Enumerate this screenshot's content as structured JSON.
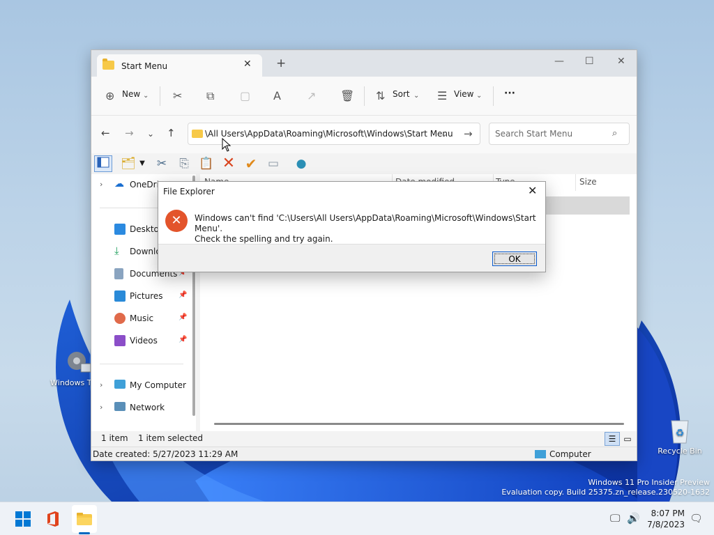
{
  "explorer": {
    "tab_title": "Start Menu",
    "tab_close": "✕",
    "new_tab": "+",
    "window_controls": {
      "minimize": "—",
      "maximize": "☐",
      "close": "✕"
    },
    "commands": {
      "new_label": "New",
      "sort_label": "Sort",
      "view_label": "View",
      "more_label": "···"
    },
    "address_path": "\\All Users\\AppData\\Roaming\\Microsoft\\Windows\\Start Menu",
    "search_placeholder": "Search Start Menu",
    "nav_items": [
      {
        "label": "OneDrive",
        "icon": "cloud-icon"
      },
      {
        "label": "Desktop",
        "icon": "desktop-icon"
      },
      {
        "label": "Downloads",
        "icon": "download-icon"
      },
      {
        "label": "Documents",
        "icon": "documents-icon"
      },
      {
        "label": "Pictures",
        "icon": "pictures-icon"
      },
      {
        "label": "Music",
        "icon": "music-icon"
      },
      {
        "label": "Videos",
        "icon": "videos-icon"
      },
      {
        "label": "My Computer",
        "icon": "computer-icon"
      },
      {
        "label": "Network",
        "icon": "network-icon"
      }
    ],
    "columns": [
      "Name",
      "Date modified",
      "Type",
      "Size"
    ],
    "status": {
      "count": "1 item",
      "selected": "1 item selected"
    },
    "info": {
      "created": "Date created: 5/27/2023 11:29 AM",
      "location": "Computer"
    }
  },
  "dialog": {
    "title": "File Explorer",
    "message_line1": "Windows can't find 'C:\\Users\\All Users\\AppData\\Roaming\\Microsoft\\Windows\\Start Menu'.",
    "message_line2": "Check the spelling and try again.",
    "ok_label": "OK"
  },
  "desktop": {
    "tools_icon_label": "Windows Tools",
    "recycle_label": "Recycle Bin",
    "watermark_line1": "Windows 11 Pro Insider Preview",
    "watermark_line2": "Evaluation copy. Build 25375.zn_release.230520-1632"
  },
  "taskbar": {
    "time": "8:07 PM",
    "date": "7/8/2023"
  },
  "colors": {
    "accent": "#0067c0",
    "error": "#e3542b",
    "folder": "#f7c948"
  }
}
